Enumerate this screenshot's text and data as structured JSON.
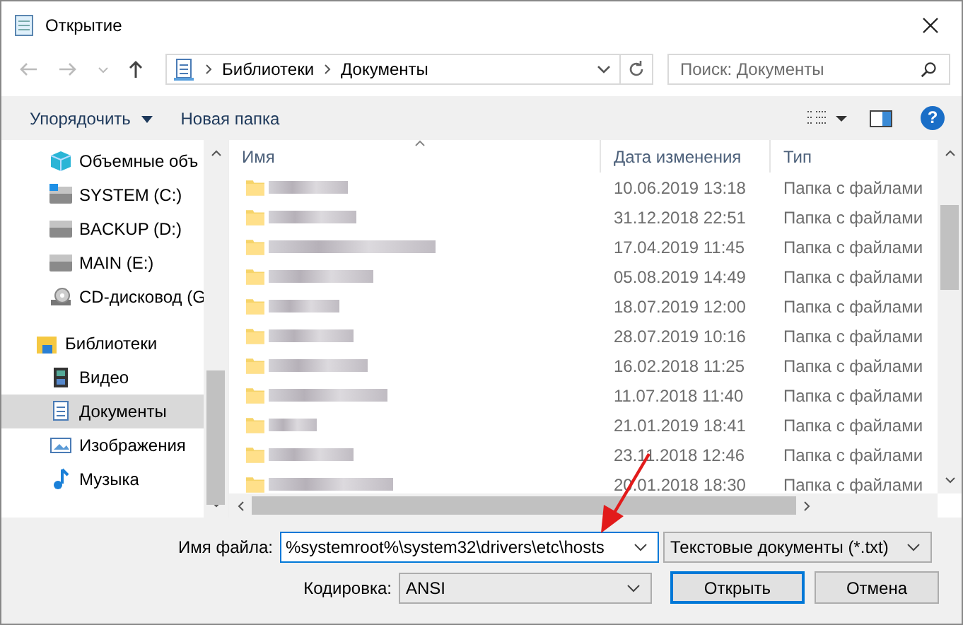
{
  "window": {
    "title": "Открытие"
  },
  "address": {
    "path": [
      "Библиотеки",
      "Документы"
    ]
  },
  "search": {
    "placeholder": "Поиск: Документы"
  },
  "toolbar": {
    "organize": "Упорядочить",
    "new_folder": "Новая папка",
    "help": "?"
  },
  "sidebar": {
    "items": [
      {
        "label": "Объемные объ",
        "kind": "cube",
        "selected": false
      },
      {
        "label": "SYSTEM (C:)",
        "kind": "system-drive",
        "selected": false
      },
      {
        "label": "BACKUP (D:)",
        "kind": "drive",
        "selected": false
      },
      {
        "label": "MAIN (E:)",
        "kind": "drive",
        "selected": false
      },
      {
        "label": "CD-дисковод (G",
        "kind": "cd",
        "selected": false
      },
      {
        "label": "Библиотеки",
        "kind": "library",
        "selected": false,
        "children": [
          {
            "label": "Видео",
            "kind": "video",
            "selected": false
          },
          {
            "label": "Документы",
            "kind": "documents",
            "selected": true
          },
          {
            "label": "Изображения",
            "kind": "pictures",
            "selected": false
          },
          {
            "label": "Музыка",
            "kind": "music",
            "selected": false
          }
        ]
      }
    ]
  },
  "table": {
    "columns": [
      {
        "label": "Имя",
        "sorted": true
      },
      {
        "label": "Дата изменения",
        "sorted": false
      },
      {
        "label": "Тип",
        "sorted": false
      }
    ],
    "rows": [
      {
        "date": "10.06.2019 13:18",
        "type": "Папка с файлами"
      },
      {
        "date": "31.12.2018 22:51",
        "type": "Папка с файлами"
      },
      {
        "date": "17.04.2019 11:45",
        "type": "Папка с файлами"
      },
      {
        "date": "05.08.2019 14:49",
        "type": "Папка с файлами"
      },
      {
        "date": "18.07.2019 12:00",
        "type": "Папка с файлами"
      },
      {
        "date": "28.07.2019 10:16",
        "type": "Папка с файлами"
      },
      {
        "date": "16.02.2018 11:25",
        "type": "Папка с файлами"
      },
      {
        "date": "11.07.2018 11:40",
        "type": "Папка с файлами"
      },
      {
        "date": "21.01.2019 18:41",
        "type": "Папка с файлами"
      },
      {
        "date": "23.11.2018 12:46",
        "type": "Папка с файлами"
      },
      {
        "date": "20.01.2018 18:30",
        "type": "Папка с файлами"
      }
    ]
  },
  "bottom": {
    "filename_label": "Имя файла:",
    "filename": "%systemroot%\\system32\\drivers\\etc\\hosts",
    "filter": "Текстовые документы (*.txt)",
    "encoding_label": "Кодировка:",
    "encoding": "ANSI",
    "open": "Открыть",
    "cancel": "Отмена"
  }
}
